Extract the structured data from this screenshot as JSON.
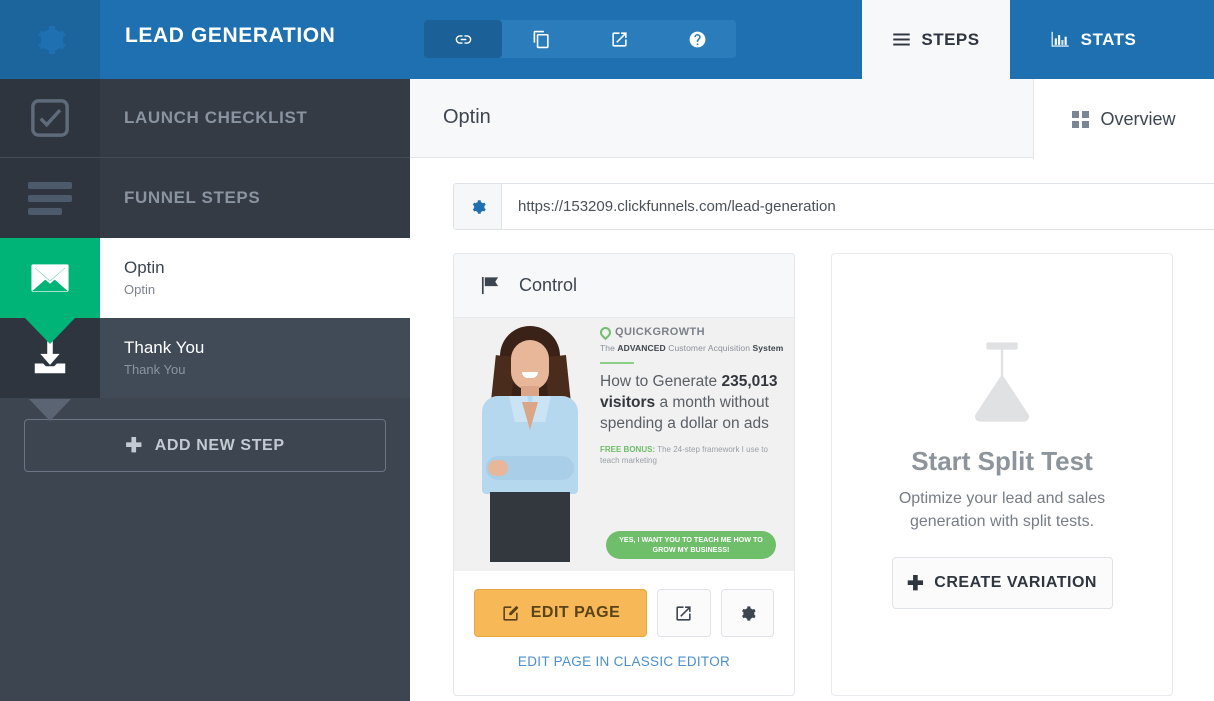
{
  "header": {
    "gear_icon": "gear-icon",
    "funnel_title": "LEAD GENERATION",
    "tools": [
      {
        "icon": "link-icon",
        "active": true
      },
      {
        "icon": "copy-icon",
        "active": false
      },
      {
        "icon": "external-link-icon",
        "active": false
      },
      {
        "icon": "help-circle-icon",
        "active": false
      }
    ],
    "tab_steps": {
      "label": "STEPS",
      "icon": "hamburger-icon",
      "active": true
    },
    "tab_stats": {
      "label": "STATS",
      "icon": "bar-chart-icon",
      "active": false
    },
    "accent_blue": "#1e70b0"
  },
  "sidebar": {
    "launch_checklist": {
      "label": "LAUNCH CHECKLIST",
      "icon": "checkbox-check-icon"
    },
    "funnel_steps": {
      "label": "FUNNEL STEPS",
      "icon": "menu-bars-icon"
    },
    "steps": [
      {
        "title": "Optin",
        "subtitle": "Optin",
        "icon": "envelope-icon",
        "active": true,
        "accent": "#00b377"
      },
      {
        "title": "Thank You",
        "subtitle": "Thank You",
        "icon": "download-tray-icon",
        "active": false
      }
    ],
    "add_step_label": "ADD NEW STEP",
    "add_step_plus": "✚"
  },
  "content": {
    "step_name": "Optin",
    "tab_overview": {
      "label": "Overview",
      "icon": "grid-icon"
    },
    "url": {
      "gear_icon": "gear-icon",
      "value": "https://153209.clickfunnels.com/lead-generation",
      "placeholder": "https://"
    },
    "control_card": {
      "flag_icon": "flag-icon",
      "title": "Control",
      "preview": {
        "brand": "QUICKGROWTH",
        "brand_icon": "leaf-icon",
        "tagline_pre": "The ",
        "tagline_b1": "ADVANCED",
        "tagline_mid": " Customer Acquisition ",
        "tagline_b2": "System",
        "headline_part1": "How to Generate ",
        "headline_bold": "235,013 visitors",
        "headline_part2": " a month without spending a dollar on ads",
        "bonus_label": "FREE BONUS:",
        "bonus_text": " The 24-step framework I use to teach marketing",
        "cta": "YES, I WANT YOU TO TEACH ME HOW TO GROW MY BUSINESS!",
        "cta_color": "#6fbe6a"
      },
      "edit_page_label": "EDIT PAGE",
      "edit_page_icon": "pencil-square-icon",
      "edit_page_color": "#f7b857",
      "preview_button_icon": "external-link-icon",
      "settings_button_icon": "gear-icon",
      "classic_editor_link": "EDIT PAGE IN CLASSIC EDITOR"
    },
    "split_card": {
      "icon": "flask-icon",
      "title": "Start Split Test",
      "description": "Optimize your lead and sales generation with split tests.",
      "button_label": "CREATE VARIATION",
      "button_plus": "✚"
    }
  }
}
